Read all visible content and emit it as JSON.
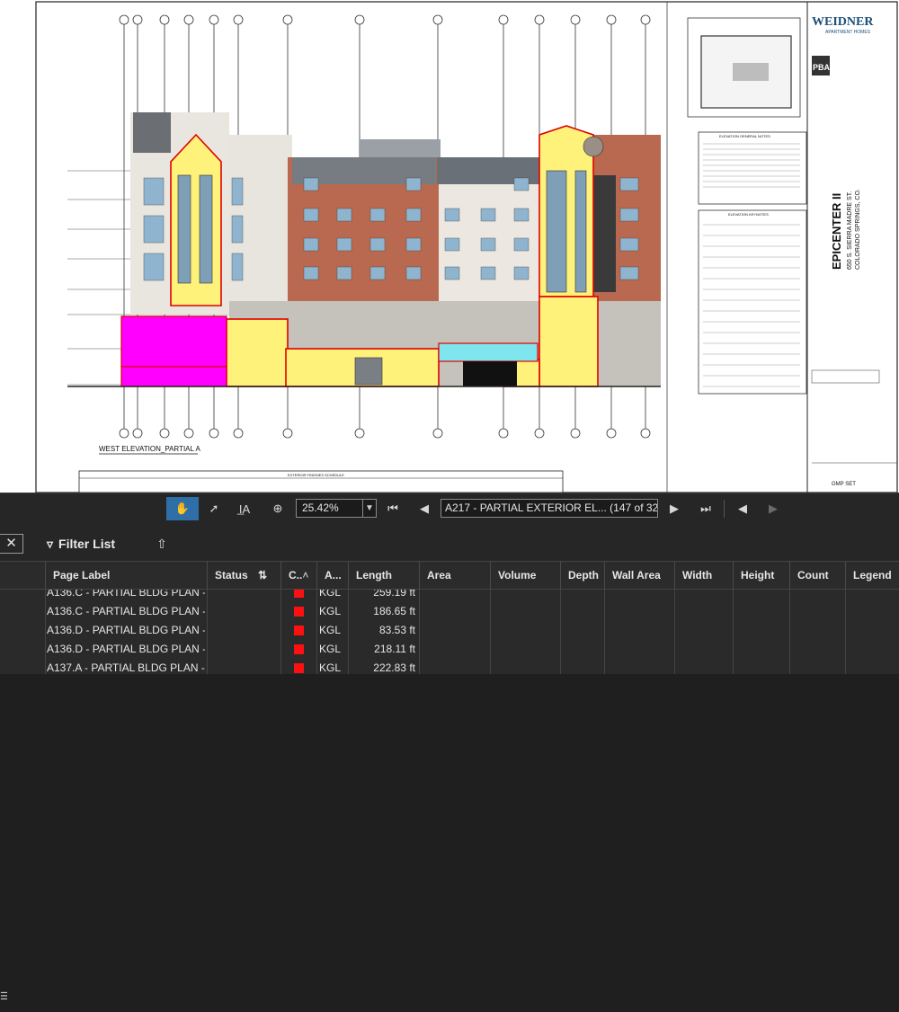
{
  "toolbar": {
    "zoom_value": "25.42%",
    "page_select_value": "A217 - PARTIAL EXTERIOR EL... (147 of 322)",
    "icons": {
      "pan": "hand-icon",
      "select": "cursor-icon",
      "text": "text-select-icon",
      "zoom": "zoom-in-icon",
      "first": "first-page-icon",
      "prev": "prev-page-icon",
      "next": "next-page-icon",
      "last": "last-page-icon",
      "back": "back-icon",
      "forward": "forward-icon"
    },
    "active_color": "#2f6fa8"
  },
  "panel": {
    "filter_label": "Filter List",
    "columns": [
      "Page Label",
      "Status",
      "C..",
      "A...",
      "Length",
      "Area",
      "Volume",
      "Depth",
      "Wall Area",
      "Width",
      "Height",
      "Count",
      "Legend"
    ],
    "rows": [
      {
        "page_label": "A136.C - PARTIAL BLDG PLAN -...",
        "author": "KGL",
        "length": "259.19 ft",
        "color": "#ff1010"
      },
      {
        "page_label": "A136.C - PARTIAL BLDG PLAN -...",
        "author": "KGL",
        "length": "186.65 ft",
        "color": "#ff1010"
      },
      {
        "page_label": "A136.D - PARTIAL BLDG PLAN -...",
        "author": "KGL",
        "length": "83.53 ft",
        "color": "#ff1010"
      },
      {
        "page_label": "A136.D - PARTIAL BLDG PLAN -...",
        "author": "KGL",
        "length": "218.11 ft",
        "color": "#ff1010"
      },
      {
        "page_label": "A137.A - PARTIAL BLDG PLAN -...",
        "author": "KGL",
        "length": "222.83 ft",
        "color": "#ff1010"
      }
    ]
  },
  "sheet": {
    "elevation_title": "WEST ELEVATION_PARTIAL A",
    "project_name": "EPICENTER II",
    "address_line_1": "650 S. SIERRA MADRE ST.",
    "address_line_2": "COLORADO SPRINGS, CO.",
    "client_logo": "WEIDNER",
    "client_sub": "APARTMENT HOMES",
    "architect_logo": "PBA",
    "general_notes_title": "ELEVATION GENERAL NOTES",
    "keynotes_title": "ELEVATION KEYNOTES",
    "schedule_title": "EXTERIOR FINISHES SCHEDULE",
    "set_label": "GMP SET",
    "colors": {
      "magenta": "#ff00ff",
      "yellow": "#fff27a",
      "cyan": "#7fe6ef",
      "brick": "#b8694f",
      "markup_red": "#e00000"
    }
  }
}
